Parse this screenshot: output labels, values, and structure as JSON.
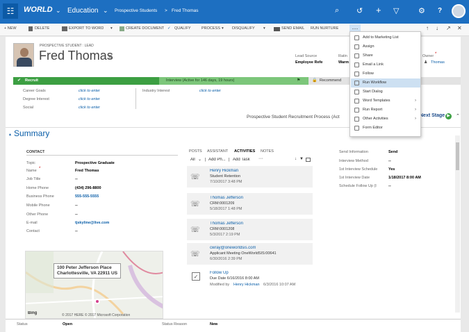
{
  "nav": {
    "grid": "☷",
    "app": "WORLD",
    "area": "Education",
    "breadcrumb1": "Prospective Students",
    "breadcrumb_sep": ">",
    "breadcrumb2": "Fred Thomas",
    "search": "⌕",
    "history": "↺",
    "add": "+",
    "filter": "▽",
    "settings": "⚙",
    "help": "?",
    "avatar": "●"
  },
  "commands": {
    "new": "+ NEW",
    "delete": "DELETE",
    "export": "EXPORT TO WORD",
    "create_doc": "CREATE DOCUMENT",
    "qualify": "QUALIFY",
    "process": "PROCESS",
    "disqualify": "DISQUALIFY",
    "send_email": "SEND EMAIL",
    "run_nurture": "RUN NURTURE",
    "more": "···",
    "up": "↑",
    "down": "↓",
    "expand": "↗",
    "close": "✕"
  },
  "record": {
    "entity": "PROSPECTIVE STUDENT : LEAD",
    "name": "Fred Thomas",
    "list_glyph": "≡",
    "lead_source_label": "Lead Source",
    "lead_source_value": "Employee Refe",
    "rating_label": "Ratin",
    "rating_value": "Warm",
    "owner_label": "Owner",
    "owner_value": "Thomas"
  },
  "bpf": {
    "recruit": "Recruit",
    "interview": "Interview (Active for 146 days, 19 hours)",
    "recommend": "Recommend",
    "career_goals": "Career Goals",
    "degree_interest": "Degree Interest",
    "social": "Social",
    "click": "click to enter",
    "industry_interest": "Industry Interest",
    "process_name": "Prospective Student Recruitment Process (Act",
    "next_stage": "Next Stage"
  },
  "summary": {
    "title": "Summary",
    "contact_heading": "CONTACT",
    "fields": [
      {
        "label": "Topic",
        "value": "Prospective Graduate"
      },
      {
        "label": "Name",
        "value": "Fred Thomas"
      },
      {
        "label": "Job Title",
        "value": "--"
      },
      {
        "label": "Home Phone",
        "value": "(434) 296-8800"
      },
      {
        "label": "Business Phone",
        "value": "555-555-5555"
      },
      {
        "label": "Mobile Phone",
        "value": "--"
      },
      {
        "label": "Other Phone",
        "value": "--"
      },
      {
        "label": "E-mail",
        "value": "tjskyline@live.com"
      },
      {
        "label": "Contact",
        "value": "--"
      }
    ],
    "address": "100 Peter Jefferson Place",
    "city": "Charlottesville, VA 22911 US",
    "map_copyright": "© 2017 HERE © 2017 Microsoft Corporation",
    "bing": "Bing"
  },
  "activities": {
    "tab_posts": "POSTS",
    "tab_assistant": "ASSISTANT",
    "tab_activities": "ACTIVITIES",
    "tab_notes": "NOTES",
    "all": "All",
    "add_phone": "Add Ph...",
    "add_task": "Add Task",
    "more": "···",
    "items": [
      {
        "who": "Henry Hickman",
        "l2": "Student Retention",
        "l3": "7/10/2017 3:48 PM"
      },
      {
        "who": "Thomas Jefferson",
        "l2": "CRM:0001209",
        "l3": "5/18/2017 1:48 PM"
      },
      {
        "who": "Thomas Jefferson",
        "l2": "CRM:0001208",
        "l3": "5/3/2017 2:19 PM"
      },
      {
        "who": "cwray@oneworldsis.com",
        "l2": "Applicant Meeting OneWorldSIS:00641",
        "l3": "6/30/2016 2:39 PM"
      },
      {
        "who": "Follow Up",
        "l2": "Due Date   6/16/2016 8:00 AM",
        "l3": "Modified by",
        "l3_link": "Henry Hickman",
        "l3_date": "6/3/2016 10:07 AM"
      }
    ]
  },
  "right": [
    {
      "label": "Send Information",
      "value": "Send"
    },
    {
      "label": "Interview Method",
      "value": "--"
    },
    {
      "label": "1st Interview Schedule",
      "value": "Yes"
    },
    {
      "label": "1st Interview Date",
      "value": "1/18/2017   8:00 AM"
    },
    {
      "label": "Schedule Follow Up (I",
      "value": "--"
    }
  ],
  "footer": {
    "status_label": "Status",
    "status_value": "Open",
    "reason_label": "Status Reason",
    "reason_value": "New"
  },
  "menu": [
    {
      "label": "Add to Marketing List"
    },
    {
      "label": "Assign"
    },
    {
      "label": "Share"
    },
    {
      "label": "Email a Link"
    },
    {
      "label": "Follow"
    },
    {
      "label": "Run Workflow"
    },
    {
      "label": "Start Dialog"
    },
    {
      "label": "Word Templates",
      "arrow": "›"
    },
    {
      "label": "Run Report",
      "arrow": "›"
    },
    {
      "label": "Other Activities",
      "arrow": "›"
    },
    {
      "label": "Form Editor"
    }
  ],
  "colors": {
    "nav": "#1d6fc1",
    "bpf_active": "#3c9f42",
    "bpf_current": "#7cc67a",
    "link": "#0a5ea8",
    "accent": "#d43f8d"
  }
}
